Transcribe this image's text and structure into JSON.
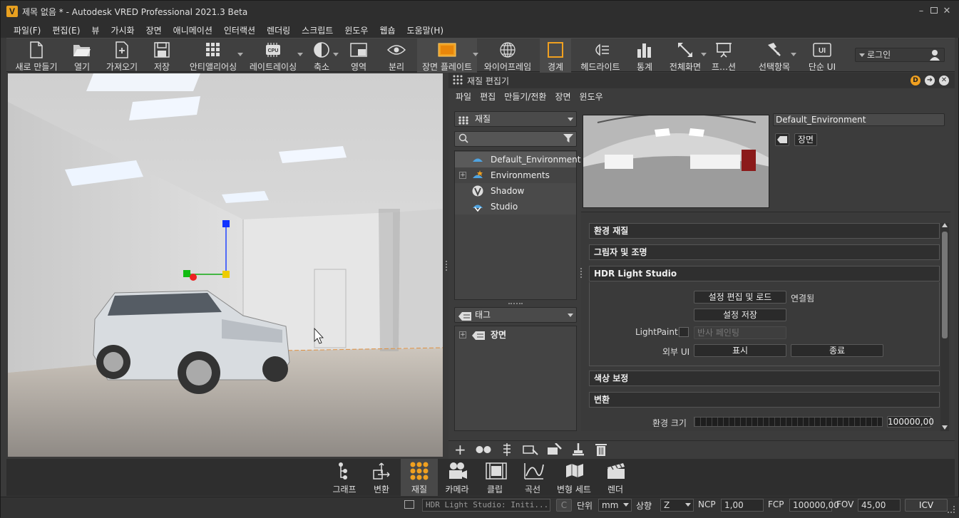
{
  "window": {
    "title": "제목 없음 * - Autodesk VRED Professional 2021.3 Beta",
    "logo": "V"
  },
  "menubar": [
    "파일(F)",
    "편집(E)",
    "뷰",
    "가시화",
    "장면",
    "애니메이션",
    "인터랙션",
    "렌더링",
    "스크립트",
    "윈도우",
    "웹숍",
    "도움말(H)"
  ],
  "toolbar": {
    "items": [
      {
        "label": "새로 만들기",
        "icon": "new-file-icon"
      },
      {
        "label": "열기",
        "icon": "folder-open-icon"
      },
      {
        "label": "가져오기",
        "icon": "import-icon"
      },
      {
        "label": "저장",
        "icon": "save-disk-icon"
      },
      {
        "label": "안티앨리어싱",
        "icon": "antialias-grid-icon"
      },
      {
        "label": "레이트레이싱",
        "icon": "cpu-icon"
      },
      {
        "label": "축소",
        "icon": "half-circle-icon"
      },
      {
        "label": "영역",
        "icon": "region-icon"
      },
      {
        "label": "분리",
        "icon": "eye-icon"
      },
      {
        "label": "장면 플레이트",
        "icon": "scene-plate-icon"
      },
      {
        "label": "와이어프레임",
        "icon": "wireframe-globe-icon"
      },
      {
        "label": "경계",
        "icon": "bounding-box-icon"
      },
      {
        "label": "헤드라이트",
        "icon": "headlight-icon"
      },
      {
        "label": "통계",
        "icon": "statistics-bars-icon"
      },
      {
        "label": "전체화면",
        "icon": "fullscreen-arrows-icon"
      },
      {
        "label": "프…션",
        "icon": "projection-icon"
      },
      {
        "label": "선택항목",
        "icon": "selection-icon"
      },
      {
        "label": "단순 UI",
        "icon": "simple-ui-icon"
      }
    ],
    "login": "로그인",
    "cpu_text": "CPU",
    "ui_text": "UI"
  },
  "editor": {
    "title": "재질 편집기",
    "menu": [
      "파일",
      "편집",
      "만들기/전환",
      "장면",
      "윈도우"
    ],
    "material_combo": "재질",
    "search_placeholder": "",
    "tree": [
      {
        "label": "Default_Environment",
        "selected": true
      },
      {
        "label": "Environments",
        "expandable": true
      },
      {
        "label": "Shadow"
      },
      {
        "label": "Studio"
      }
    ],
    "tag_combo": "태그",
    "tag_tree": [
      {
        "label": "장면",
        "expandable": true
      }
    ],
    "name_field": "Default_Environment",
    "tag_button": "장면",
    "sections": {
      "env_material": "환경 재질",
      "shadow_light": "그림자 및 조명",
      "hdr_studio": "HDR Light Studio",
      "color_correction": "색상 보정",
      "transform": "변환"
    },
    "hdr": {
      "edit_load_btn": "설정 편집 및 로드",
      "connected": "연결됨",
      "save_btn": "설정 저장",
      "lightpaint_label": "LightPaint",
      "lightpaint_mode": "반사 페인팅",
      "external_ui_label": "외부 UI",
      "show_btn": "표시",
      "exit_btn": "종료"
    },
    "transform": {
      "env_size_label": "환경 크기",
      "env_size_value": "100000,00"
    }
  },
  "modules": [
    {
      "label": "그래프",
      "icon": "graph-icon"
    },
    {
      "label": "변환",
      "icon": "transform-icon"
    },
    {
      "label": "재질",
      "icon": "material-dots-icon",
      "active": true
    },
    {
      "label": "카메라",
      "icon": "camera-icon"
    },
    {
      "label": "클립",
      "icon": "clip-film-icon"
    },
    {
      "label": "곡선",
      "icon": "curve-icon"
    },
    {
      "label": "변형 세트",
      "icon": "variant-sets-icon"
    },
    {
      "label": "렌더",
      "icon": "render-clapper-icon"
    }
  ],
  "status": {
    "message": "HDR Light Studio: Initi...",
    "c_label": "C",
    "unit_label": "단위",
    "unit_value": "mm",
    "up_label": "상향",
    "up_value": "Z",
    "ncp_label": "NCP",
    "ncp_value": "1,00",
    "fcp_label": "FCP",
    "fcp_value": "100000,00",
    "fov_label": "FOV",
    "fov_value": "45,00",
    "icv": "ICV"
  },
  "colors": {
    "accent": "#f0a020",
    "background": "#3a3a3a",
    "selection": "#5a5a5a"
  }
}
